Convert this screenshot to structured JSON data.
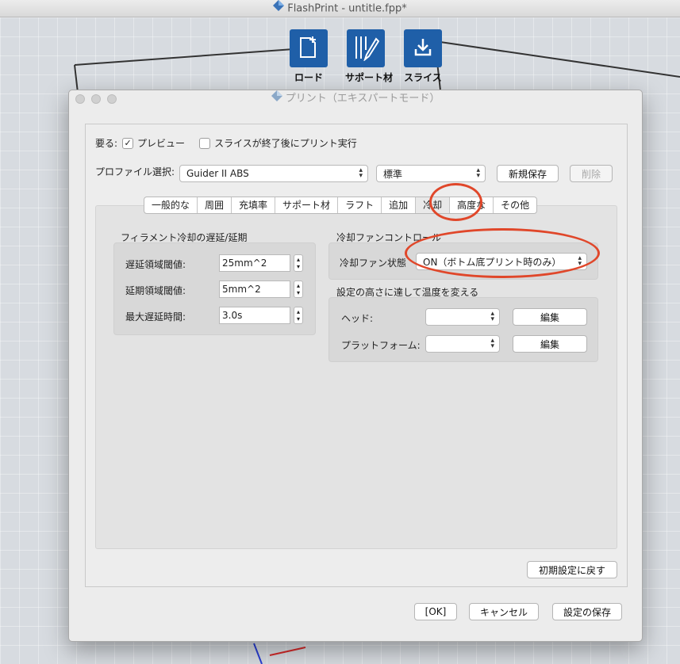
{
  "app": {
    "window_title": "FlashPrint - untitle.fpp*",
    "toolbar": [
      {
        "label": "ロード",
        "icon": "file-add-icon"
      },
      {
        "label": "サポート材",
        "icon": "support-icon"
      },
      {
        "label": "スライス",
        "icon": "slice-icon"
      }
    ]
  },
  "dialog": {
    "title": "プリント（エキスパートモード）",
    "needs_label": "要る:",
    "preview": {
      "label": "プレビュー",
      "checked": true
    },
    "print_after_slice": {
      "label": "スライスが終了後にプリント実行",
      "checked": false
    },
    "profile_label": "プロファイル選択:",
    "profile_value": "Guider II ABS",
    "quality_value": "標準",
    "new_save_label": "新規保存",
    "delete_label": "削除",
    "tabs": [
      "一般的な",
      "周囲",
      "充填率",
      "サポート材",
      "ラフト",
      "追加",
      "冷却",
      "高度な",
      "その他"
    ],
    "active_tab": "冷却",
    "filament_cooling": {
      "title": "フィラメント冷却の遅延/延期",
      "fields": [
        {
          "label": "遅延領域閾値:",
          "value": "25mm^2"
        },
        {
          "label": "延期領域閾値:",
          "value": "5mm^2"
        },
        {
          "label": "最大遅延時間:",
          "value": "3.0s"
        }
      ]
    },
    "fan_control": {
      "title": "冷却ファンコントロール",
      "state_label": "冷却ファン状態",
      "state_value": "ON（ボトム底プリント時のみ）"
    },
    "temp_change": {
      "title": "設定の高さに達して温度を変える",
      "head_label": "ヘッド:",
      "platform_label": "プラットフォーム:",
      "edit_label": "編集"
    },
    "reset_label": "初期設定に戻す",
    "ok_label": "[OK]",
    "cancel_label": "キャンセル",
    "save_label": "設定の保存"
  },
  "colors": {
    "toolbar_blue": "#1f5fa8",
    "highlight_red": "#e0472a"
  }
}
